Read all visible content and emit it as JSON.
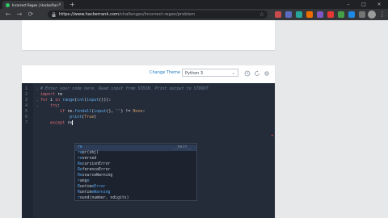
{
  "browser": {
    "tab_title": "Incorrect Regex | HackerRank",
    "tab_close": "×",
    "new_tab": "+",
    "window_controls": [
      "–",
      "□",
      "×"
    ],
    "url_host": "https://www.hackerrank.com",
    "url_path": "/challenges/incorrect-regex/problem",
    "back": "←",
    "forward": "→",
    "reload": "⟳",
    "menu": "⋮",
    "star": "☆",
    "colors": {
      "tabbar": "#202124",
      "toolbar": "#35363a",
      "favicon": "#2ec866"
    }
  },
  "editor": {
    "change_theme": "Change Theme",
    "language": "Python 3",
    "language_caret": "⌄",
    "line_numbers": [
      "1",
      "2",
      "3",
      "4",
      "5",
      "6",
      "7"
    ],
    "fold_markers": [
      "⌄",
      "",
      "⌄",
      "⌄",
      "",
      "",
      ""
    ],
    "lines": [
      [
        {
          "t": "# Enter your code here. Read input from STDIN. Print output to STDOUT",
          "c": "cm"
        }
      ],
      [
        {
          "t": "import ",
          "c": "kw"
        },
        {
          "t": "re",
          "c": "tx"
        }
      ],
      [
        {
          "t": "for ",
          "c": "kw"
        },
        {
          "t": "i ",
          "c": "tx"
        },
        {
          "t": "in ",
          "c": "kw"
        },
        {
          "t": "range",
          "c": "fn"
        },
        {
          "t": "(",
          "c": "tx"
        },
        {
          "t": "int",
          "c": "fn"
        },
        {
          "t": "(",
          "c": "tx"
        },
        {
          "t": "input",
          "c": "fn"
        },
        {
          "t": "())):",
          "c": "tx"
        }
      ],
      [
        {
          "t": "    try",
          "c": "kw"
        },
        {
          "t": ":",
          "c": "tx"
        }
      ],
      [
        {
          "t": "        if ",
          "c": "kw"
        },
        {
          "t": "re.",
          "c": "tx"
        },
        {
          "t": "findall",
          "c": "fn"
        },
        {
          "t": "(",
          "c": "tx"
        },
        {
          "t": "input",
          "c": "fn"
        },
        {
          "t": "(), ",
          "c": "tx"
        },
        {
          "t": "''",
          "c": "st"
        },
        {
          "t": ") != ",
          "c": "tx"
        },
        {
          "t": "None",
          "c": "nm"
        },
        {
          "t": ":",
          "c": "tx"
        }
      ],
      [
        {
          "t": "            ",
          "c": "tx"
        },
        {
          "t": "print",
          "c": "fn"
        },
        {
          "t": "(",
          "c": "tx"
        },
        {
          "t": "True",
          "c": "nm"
        },
        {
          "t": ")",
          "c": "tx"
        }
      ],
      [
        {
          "t": "    except ",
          "c": "kw"
        },
        {
          "t": "re",
          "c": "tx"
        }
      ]
    ],
    "error_marker": "•",
    "colors": {
      "background": "#242c3a",
      "gutter": "#1f2633"
    }
  },
  "autocomplete": {
    "typed": "re",
    "items": [
      {
        "match": "re",
        "rest": "",
        "meta": "__main__",
        "selected": true
      },
      {
        "match": "re",
        "rest": "pr(obj)",
        "meta": "",
        "selected": false
      },
      {
        "match": "re",
        "rest": "versed",
        "meta": "",
        "selected": false
      },
      {
        "match": "Re",
        "rest": "cursionError",
        "meta": "",
        "selected": false
      },
      {
        "match": "Re",
        "rest": "ferenceError",
        "meta": "",
        "selected": false
      },
      {
        "match": "Re",
        "rest": "sourceWarning",
        "meta": "",
        "selected": false
      },
      {
        "match": "r",
        "rest": "ang",
        "match2": "e",
        "meta": "",
        "selected": false
      },
      {
        "match": "R",
        "rest": "untim",
        "match2": "eError",
        "meta": "",
        "selected": false
      },
      {
        "match": "R",
        "rest": "untim",
        "match2": "eWarning",
        "meta": "",
        "selected": false
      },
      {
        "match": "r",
        "rest": "ound(number, ndigits)",
        "meta": "",
        "selected": false
      }
    ]
  }
}
